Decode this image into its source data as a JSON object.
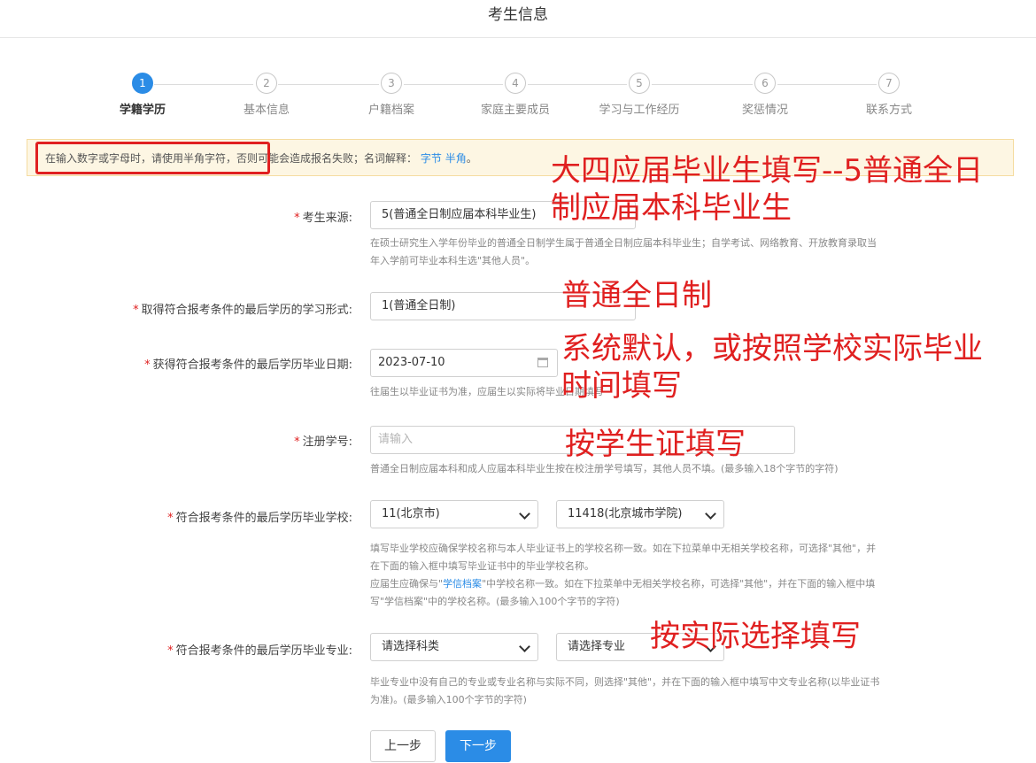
{
  "header": {
    "title": "考生信息"
  },
  "steps": [
    {
      "num": "1",
      "label": "学籍学历"
    },
    {
      "num": "2",
      "label": "基本信息"
    },
    {
      "num": "3",
      "label": "户籍档案"
    },
    {
      "num": "4",
      "label": "家庭主要成员"
    },
    {
      "num": "5",
      "label": "学习与工作经历"
    },
    {
      "num": "6",
      "label": "奖惩情况"
    },
    {
      "num": "7",
      "label": "联系方式"
    }
  ],
  "notice": {
    "text": "在输入数字或字母时，请使用半角字符，否则可能会造成报名失败；名词解释：",
    "link1": "字节",
    "link2": "半角",
    "end": "。"
  },
  "form": {
    "source": {
      "label": "考生来源:",
      "value": "5(普通全日制应届本科毕业生)",
      "help1": "在硕士研究生入学年份毕业的普通全日制学生属于普通全日制应届本科毕业生；自学考试、网络教育、开放教育录取当",
      "help2": "年入学前可毕业本科生选\"其他人员\"。"
    },
    "study_form": {
      "label": "取得符合报考条件的最后学历的学习形式:",
      "value": "1(普通全日制)"
    },
    "grad_date": {
      "label": "获得符合报考条件的最后学历毕业日期:",
      "value": "2023-07-10",
      "help": "往届生以毕业证书为准，应届生以实际将毕业日期填写"
    },
    "reg_no": {
      "label": "注册学号:",
      "placeholder": "请输入",
      "help": "普通全日制应届本科和成人应届本科毕业生按在校注册学号填写，其他人员不填。(最多输入18个字节的字符)"
    },
    "school": {
      "label": "符合报考条件的最后学历毕业学校:",
      "province": "11(北京市)",
      "school": "11418(北京城市学院)",
      "help1": "填写毕业学校应确保学校名称与本人毕业证书上的学校名称一致。如在下拉菜单中无相关学校名称，可选择\"其他\"，并",
      "help2": "在下面的输入框中填写毕业证书中的毕业学校名称。",
      "help3a": "应届生应确保与\"",
      "help3link": "学信档案",
      "help3b": "\"中学校名称一致。如在下拉菜单中无相关学校名称，可选择\"其他\"，并在下面的输入框中填",
      "help4": "写\"学信档案\"中的学校名称。(最多输入100个字节的字符)"
    },
    "major": {
      "label": "符合报考条件的最后学历毕业专业:",
      "category": "请选择科类",
      "major": "请选择专业",
      "help1": "毕业专业中没有自己的专业或专业名称与实际不同，则选择\"其他\"，并在下面的输入框中填写中文专业名称(以毕业证书",
      "help2": "为准)。(最多输入100个字节的字符)"
    },
    "required_mark": "*"
  },
  "buttons": {
    "prev": "上一步",
    "next": "下一步"
  },
  "annotations": {
    "a1_line1": "大四应届毕业生填写--5普通全日",
    "a1_line2": "制应届本科毕业生",
    "a2": "普通全日制",
    "a3_line1": "系统默认，或按照学校实际毕业",
    "a3_line2": "时间填写",
    "a4": "按学生证填写",
    "a5": "按实际选择填写"
  },
  "colors": {
    "accent": "#2b8ce6",
    "annotation": "#e02020",
    "notice_bg": "#fdf6e3"
  }
}
